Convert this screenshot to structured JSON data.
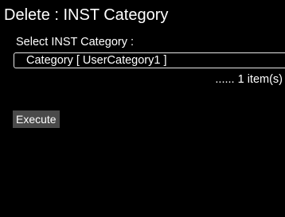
{
  "dialog": {
    "title": "Delete : INST Category",
    "prompt": "Select INST Category :",
    "selected_category": "Category [ UserCategory1 ]",
    "item_count_text": "...... 1 item(s)",
    "execute_label": "Execute"
  },
  "colors": {
    "background": "#000000",
    "text": "#ffffff",
    "button_bg": "#4a4a4a",
    "box_border": "#e6e6e6"
  }
}
